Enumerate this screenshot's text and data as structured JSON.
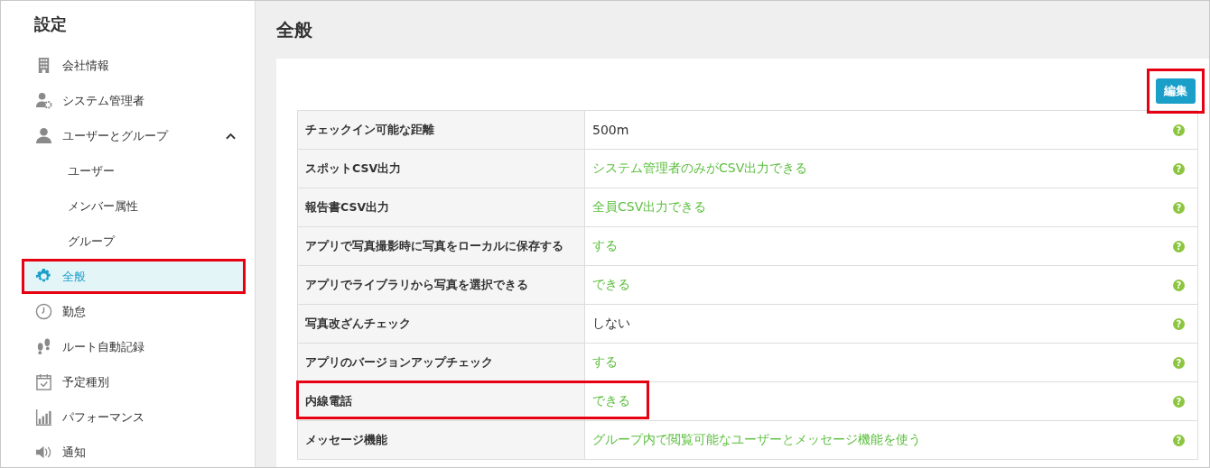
{
  "sidebar": {
    "title": "設定",
    "items": [
      {
        "label": "会社情報",
        "selected": false,
        "highlighted": false
      },
      {
        "label": "システム管理者",
        "selected": false,
        "highlighted": false
      },
      {
        "label": "ユーザーとグループ",
        "selected": false,
        "highlighted": false,
        "expanded": true,
        "children": [
          {
            "label": "ユーザー"
          },
          {
            "label": "メンバー属性"
          },
          {
            "label": "グループ"
          }
        ]
      },
      {
        "label": "全般",
        "selected": true,
        "highlighted": true
      },
      {
        "label": "勤怠",
        "selected": false,
        "highlighted": false
      },
      {
        "label": "ルート自動記録",
        "selected": false,
        "highlighted": false
      },
      {
        "label": "予定種別",
        "selected": false,
        "highlighted": false
      },
      {
        "label": "パフォーマンス",
        "selected": false,
        "highlighted": false
      },
      {
        "label": "通知",
        "selected": false,
        "highlighted": false
      }
    ]
  },
  "main": {
    "title": "全般",
    "edit_button": {
      "label": "編集",
      "highlighted": true
    },
    "settings": [
      {
        "label": "チェックイン可能な距離",
        "value": "500m",
        "color": "#333333",
        "help": "?",
        "highlighted": false
      },
      {
        "label": "スポットCSV出力",
        "value": "システム管理者のみがCSV出力できる",
        "color": "#5cbf3f",
        "help": "?",
        "highlighted": false
      },
      {
        "label": "報告書CSV出力",
        "value": "全員CSV出力できる",
        "color": "#5cbf3f",
        "help": "?",
        "highlighted": false
      },
      {
        "label": "アプリで写真撮影時に写真をローカルに保存する",
        "value": "する",
        "color": "#5cbf3f",
        "help": "?",
        "highlighted": false
      },
      {
        "label": "アプリでライブラリから写真を選択できる",
        "value": "できる",
        "color": "#5cbf3f",
        "help": "?",
        "highlighted": false
      },
      {
        "label": "写真改ざんチェック",
        "value": "しない",
        "color": "#333333",
        "help": "?",
        "highlighted": false
      },
      {
        "label": "アプリのバージョンアップチェック",
        "value": "する",
        "color": "#5cbf3f",
        "help": "?",
        "highlighted": false
      },
      {
        "label": "内線電話",
        "value": "できる",
        "color": "#5cbf3f",
        "help": "?",
        "highlighted": true
      },
      {
        "label": "メッセージ機能",
        "value": "グループ内で閲覧可能なユーザーとメッセージ機能を使う",
        "color": "#5cbf3f",
        "help": "?",
        "highlighted": false
      }
    ]
  }
}
